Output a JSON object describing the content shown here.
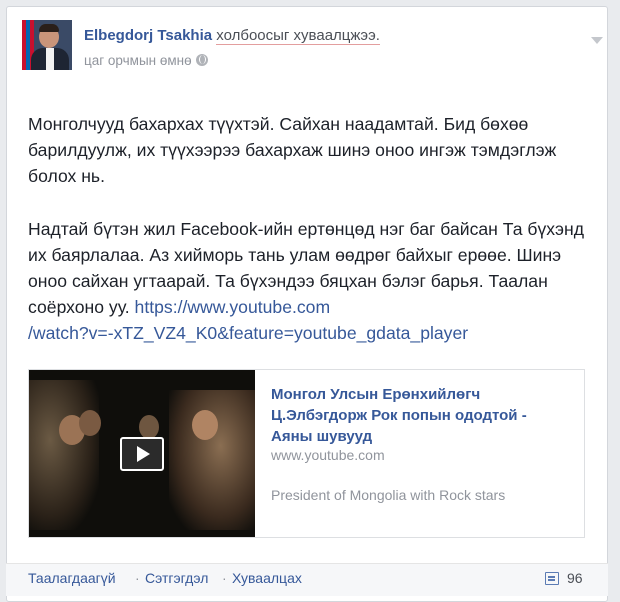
{
  "post": {
    "author": "Elbegdorj Tsakhia",
    "action": "холбоосыг хуваалцжээ.",
    "timestamp": "цаг орчмын өмнө",
    "privacy_icon": "globe-icon",
    "paragraph1": "Монголчууд бахархах түүхтэй. Сайхан наадамтай. Бид бөхөө барилдуулж, их түүхээрээ бахархаж шинэ оноо ингэж тэмдэглэж болох нь.",
    "paragraph2": "Надтай бүтэн жил Facebook-ийн ертөнцөд нэг баг байсан Та бүхэнд их баярлалаа. Аз хийморь тань улам өөдрөг байхыг ерөөе. Шинэ оноо сайхан угтаарай. Та бүхэндээ бяцхан бэлэг барья. Таалан соёрхоно уу.",
    "link_line1": "https://www.youtube.com",
    "link_line2": "/watch?v=-xTZ_VZ4_K0&feature=youtube_gdata_player"
  },
  "shared": {
    "title": "Монгол Улсын Ерөнхийлөгч Ц.Элбэгдорж Рок попын ододтой - Аяны шувууд",
    "domain": "www.youtube.com",
    "description": "President of Mongolia with Rock stars",
    "play_icon": "play-icon"
  },
  "footer": {
    "like": "Таалагдаагүй",
    "comment": "Сэтгэгдэл",
    "share": "Хуваалцах",
    "separator": "·",
    "comment_count": "96",
    "comment_icon": "comment-icon"
  }
}
